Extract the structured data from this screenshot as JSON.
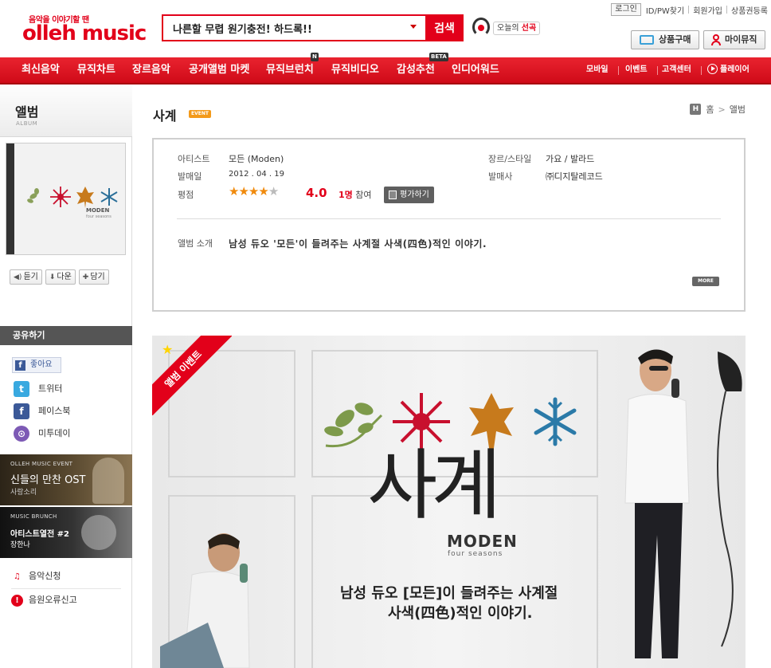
{
  "header": {
    "tagline": "음악을 이야기할 땐",
    "logo": "olleh music",
    "search_value": "나른할 무렵 원기충전! 하드록!!",
    "search_button": "검색",
    "today_prefix": "오늘의",
    "today_highlight": "선곡",
    "util": {
      "login": "로그인",
      "find": "ID/PW찾기",
      "join": "회원가입",
      "register": "상품권등록"
    },
    "buy_button": "상품구매",
    "my_button": "마이뮤직"
  },
  "gnb": {
    "items": [
      "최신음악",
      "뮤직차트",
      "장르음악",
      "공개앨범 마켓",
      "뮤직브런치",
      "뮤직비디오",
      "감성추천",
      "인디어워드"
    ],
    "badges": {
      "new": "N",
      "beta": "BETA"
    },
    "right": [
      "모바일",
      "이벤트",
      "고객센터",
      "플레이어"
    ]
  },
  "sidebar": {
    "title": "앨범",
    "subtitle": "ALBUM",
    "cover": {
      "title": "MODEN",
      "subtitle": "four seasons"
    },
    "buttons": [
      "듣기",
      "다운",
      "담기"
    ],
    "share_title": "공유하기",
    "like": "좋아요",
    "share": [
      "트위터",
      "페이스북",
      "미투데이"
    ],
    "banner1": {
      "kicker": "OLLEH MUSIC EVENT",
      "headline": "신들의 만찬 OST",
      "sub": "사랑소리"
    },
    "banner2": {
      "kicker": "MUSIC BRUNCH",
      "headline": "아티스트열전 #2",
      "sub": "장한나"
    },
    "links": [
      "음악신청",
      "음원오류신고"
    ]
  },
  "album": {
    "title": "사계",
    "event_badge": "EVENT",
    "breadcrumb": {
      "icon": "H",
      "home": "홈",
      "current": "앨범"
    },
    "labels": {
      "artist": "아티스트",
      "release": "발매일",
      "rating": "평점",
      "genre": "장르/스타일",
      "publisher": "발매사",
      "intro": "앨범 소개"
    },
    "artist": "모든 (Moden)",
    "release_date": "2012 . 04 . 19",
    "genre": "가요 / 발라드",
    "publisher": "㈜디지탈레코드",
    "rating": 4.0,
    "rating_text": "4.0",
    "rating_stars": 4,
    "voters_count": "1명",
    "voters_suffix": "참여",
    "rate_button": "평가하기",
    "intro": "남성 듀오 '모든'이 들려주는 사계절 사색(四色)적인 이야기.",
    "more": "MORE"
  },
  "event_banner": {
    "ribbon": "앨범 이벤트",
    "big_title": "사계",
    "brand": "MODEN",
    "brand_sub": "four seasons",
    "copy_line1": "남성 듀오 [모든]이 들려주는 사계절",
    "copy_line2": "사색(四色)적인 이야기."
  },
  "colors": {
    "brand_red": "#e2001a",
    "star": "#f08a0c",
    "event_orange": "#f39a1a"
  }
}
